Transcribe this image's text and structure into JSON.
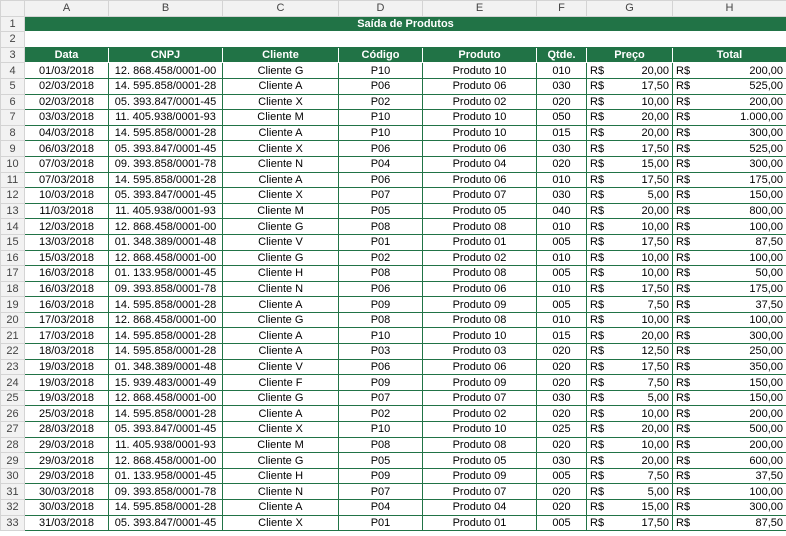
{
  "columns": [
    "A",
    "B",
    "C",
    "D",
    "E",
    "F",
    "G",
    "H"
  ],
  "title": "Saída de Produtos",
  "headers": [
    "Data",
    "CNPJ",
    "Cliente",
    "Código",
    "Produto",
    "Qtde.",
    "Preço",
    "Total"
  ],
  "currency": "R$",
  "rows": [
    {
      "n": "4",
      "data": "01/03/2018",
      "cnpj": "12. 868.458/0001-00",
      "cliente": "Cliente G",
      "codigo": "P10",
      "produto": "Produto 10",
      "qtde": "010",
      "preco": "20,00",
      "total": "200,00"
    },
    {
      "n": "5",
      "data": "02/03/2018",
      "cnpj": "14. 595.858/0001-28",
      "cliente": "Cliente A",
      "codigo": "P06",
      "produto": "Produto 06",
      "qtde": "030",
      "preco": "17,50",
      "total": "525,00"
    },
    {
      "n": "6",
      "data": "02/03/2018",
      "cnpj": "05. 393.847/0001-45",
      "cliente": "Cliente X",
      "codigo": "P02",
      "produto": "Produto 02",
      "qtde": "020",
      "preco": "10,00",
      "total": "200,00"
    },
    {
      "n": "7",
      "data": "03/03/2018",
      "cnpj": "11. 405.938/0001-93",
      "cliente": "Cliente M",
      "codigo": "P10",
      "produto": "Produto 10",
      "qtde": "050",
      "preco": "20,00",
      "total": "1.000,00"
    },
    {
      "n": "8",
      "data": "04/03/2018",
      "cnpj": "14. 595.858/0001-28",
      "cliente": "Cliente A",
      "codigo": "P10",
      "produto": "Produto 10",
      "qtde": "015",
      "preco": "20,00",
      "total": "300,00"
    },
    {
      "n": "9",
      "data": "06/03/2018",
      "cnpj": "05. 393.847/0001-45",
      "cliente": "Cliente X",
      "codigo": "P06",
      "produto": "Produto 06",
      "qtde": "030",
      "preco": "17,50",
      "total": "525,00"
    },
    {
      "n": "10",
      "data": "07/03/2018",
      "cnpj": "09. 393.858/0001-78",
      "cliente": "Cliente N",
      "codigo": "P04",
      "produto": "Produto 04",
      "qtde": "020",
      "preco": "15,00",
      "total": "300,00"
    },
    {
      "n": "11",
      "data": "07/03/2018",
      "cnpj": "14. 595.858/0001-28",
      "cliente": "Cliente A",
      "codigo": "P06",
      "produto": "Produto 06",
      "qtde": "010",
      "preco": "17,50",
      "total": "175,00"
    },
    {
      "n": "12",
      "data": "10/03/2018",
      "cnpj": "05. 393.847/0001-45",
      "cliente": "Cliente X",
      "codigo": "P07",
      "produto": "Produto 07",
      "qtde": "030",
      "preco": "5,00",
      "total": "150,00"
    },
    {
      "n": "13",
      "data": "11/03/2018",
      "cnpj": "11. 405.938/0001-93",
      "cliente": "Cliente M",
      "codigo": "P05",
      "produto": "Produto 05",
      "qtde": "040",
      "preco": "20,00",
      "total": "800,00"
    },
    {
      "n": "14",
      "data": "12/03/2018",
      "cnpj": "12. 868.458/0001-00",
      "cliente": "Cliente G",
      "codigo": "P08",
      "produto": "Produto 08",
      "qtde": "010",
      "preco": "10,00",
      "total": "100,00"
    },
    {
      "n": "15",
      "data": "13/03/2018",
      "cnpj": "01. 348.389/0001-48",
      "cliente": "Cliente V",
      "codigo": "P01",
      "produto": "Produto 01",
      "qtde": "005",
      "preco": "17,50",
      "total": "87,50"
    },
    {
      "n": "16",
      "data": "15/03/2018",
      "cnpj": "12. 868.458/0001-00",
      "cliente": "Cliente G",
      "codigo": "P02",
      "produto": "Produto 02",
      "qtde": "010",
      "preco": "10,00",
      "total": "100,00"
    },
    {
      "n": "17",
      "data": "16/03/2018",
      "cnpj": "01. 133.958/0001-45",
      "cliente": "Cliente H",
      "codigo": "P08",
      "produto": "Produto 08",
      "qtde": "005",
      "preco": "10,00",
      "total": "50,00"
    },
    {
      "n": "18",
      "data": "16/03/2018",
      "cnpj": "09. 393.858/0001-78",
      "cliente": "Cliente N",
      "codigo": "P06",
      "produto": "Produto 06",
      "qtde": "010",
      "preco": "17,50",
      "total": "175,00"
    },
    {
      "n": "19",
      "data": "16/03/2018",
      "cnpj": "14. 595.858/0001-28",
      "cliente": "Cliente A",
      "codigo": "P09",
      "produto": "Produto 09",
      "qtde": "005",
      "preco": "7,50",
      "total": "37,50"
    },
    {
      "n": "20",
      "data": "17/03/2018",
      "cnpj": "12. 868.458/0001-00",
      "cliente": "Cliente G",
      "codigo": "P08",
      "produto": "Produto 08",
      "qtde": "010",
      "preco": "10,00",
      "total": "100,00"
    },
    {
      "n": "21",
      "data": "17/03/2018",
      "cnpj": "14. 595.858/0001-28",
      "cliente": "Cliente A",
      "codigo": "P10",
      "produto": "Produto 10",
      "qtde": "015",
      "preco": "20,00",
      "total": "300,00"
    },
    {
      "n": "22",
      "data": "18/03/2018",
      "cnpj": "14. 595.858/0001-28",
      "cliente": "Cliente A",
      "codigo": "P03",
      "produto": "Produto 03",
      "qtde": "020",
      "preco": "12,50",
      "total": "250,00"
    },
    {
      "n": "23",
      "data": "19/03/2018",
      "cnpj": "01. 348.389/0001-48",
      "cliente": "Cliente V",
      "codigo": "P06",
      "produto": "Produto 06",
      "qtde": "020",
      "preco": "17,50",
      "total": "350,00"
    },
    {
      "n": "24",
      "data": "19/03/2018",
      "cnpj": "15. 939.483/0001-49",
      "cliente": "Cliente F",
      "codigo": "P09",
      "produto": "Produto 09",
      "qtde": "020",
      "preco": "7,50",
      "total": "150,00"
    },
    {
      "n": "25",
      "data": "19/03/2018",
      "cnpj": "12. 868.458/0001-00",
      "cliente": "Cliente G",
      "codigo": "P07",
      "produto": "Produto 07",
      "qtde": "030",
      "preco": "5,00",
      "total": "150,00"
    },
    {
      "n": "26",
      "data": "25/03/2018",
      "cnpj": "14. 595.858/0001-28",
      "cliente": "Cliente A",
      "codigo": "P02",
      "produto": "Produto 02",
      "qtde": "020",
      "preco": "10,00",
      "total": "200,00"
    },
    {
      "n": "27",
      "data": "28/03/2018",
      "cnpj": "05. 393.847/0001-45",
      "cliente": "Cliente X",
      "codigo": "P10",
      "produto": "Produto 10",
      "qtde": "025",
      "preco": "20,00",
      "total": "500,00"
    },
    {
      "n": "28",
      "data": "29/03/2018",
      "cnpj": "11. 405.938/0001-93",
      "cliente": "Cliente M",
      "codigo": "P08",
      "produto": "Produto 08",
      "qtde": "020",
      "preco": "10,00",
      "total": "200,00"
    },
    {
      "n": "29",
      "data": "29/03/2018",
      "cnpj": "12. 868.458/0001-00",
      "cliente": "Cliente G",
      "codigo": "P05",
      "produto": "Produto 05",
      "qtde": "030",
      "preco": "20,00",
      "total": "600,00"
    },
    {
      "n": "30",
      "data": "29/03/2018",
      "cnpj": "01. 133.958/0001-45",
      "cliente": "Cliente H",
      "codigo": "P09",
      "produto": "Produto 09",
      "qtde": "005",
      "preco": "7,50",
      "total": "37,50"
    },
    {
      "n": "31",
      "data": "30/03/2018",
      "cnpj": "09. 393.858/0001-78",
      "cliente": "Cliente N",
      "codigo": "P07",
      "produto": "Produto 07",
      "qtde": "020",
      "preco": "5,00",
      "total": "100,00"
    },
    {
      "n": "32",
      "data": "30/03/2018",
      "cnpj": "14. 595.858/0001-28",
      "cliente": "Cliente A",
      "codigo": "P04",
      "produto": "Produto 04",
      "qtde": "020",
      "preco": "15,00",
      "total": "300,00"
    },
    {
      "n": "33",
      "data": "31/03/2018",
      "cnpj": "05. 393.847/0001-45",
      "cliente": "Cliente X",
      "codigo": "P01",
      "produto": "Produto 01",
      "qtde": "005",
      "preco": "17,50",
      "total": "87,50"
    }
  ],
  "colors": {
    "header_green": "#217346",
    "header_text": "#ffffff",
    "grid_gray": "#d4d4d4"
  }
}
